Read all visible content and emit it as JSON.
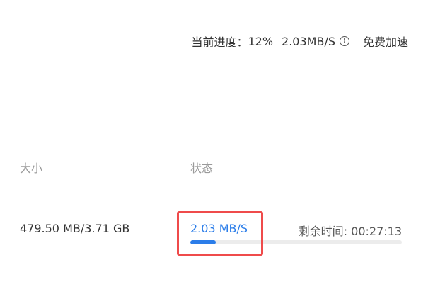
{
  "topbar": {
    "progress_label": "当前进度：",
    "progress_value": "12%",
    "speed": "2.03MB/S",
    "info_icon": "info-circle-icon",
    "boost_label": "免费加速"
  },
  "columns": {
    "size_header": "大小",
    "status_header": "状态"
  },
  "row": {
    "size": "479.50 MB/3.71 GB",
    "speed": "2.03 MB/S",
    "remaining": "剩余时间: 00:27:13",
    "progress_fraction": 0.12
  },
  "colors": {
    "accent": "#2b7de9",
    "highlight": "#ef4b4b",
    "track": "#ececec"
  }
}
